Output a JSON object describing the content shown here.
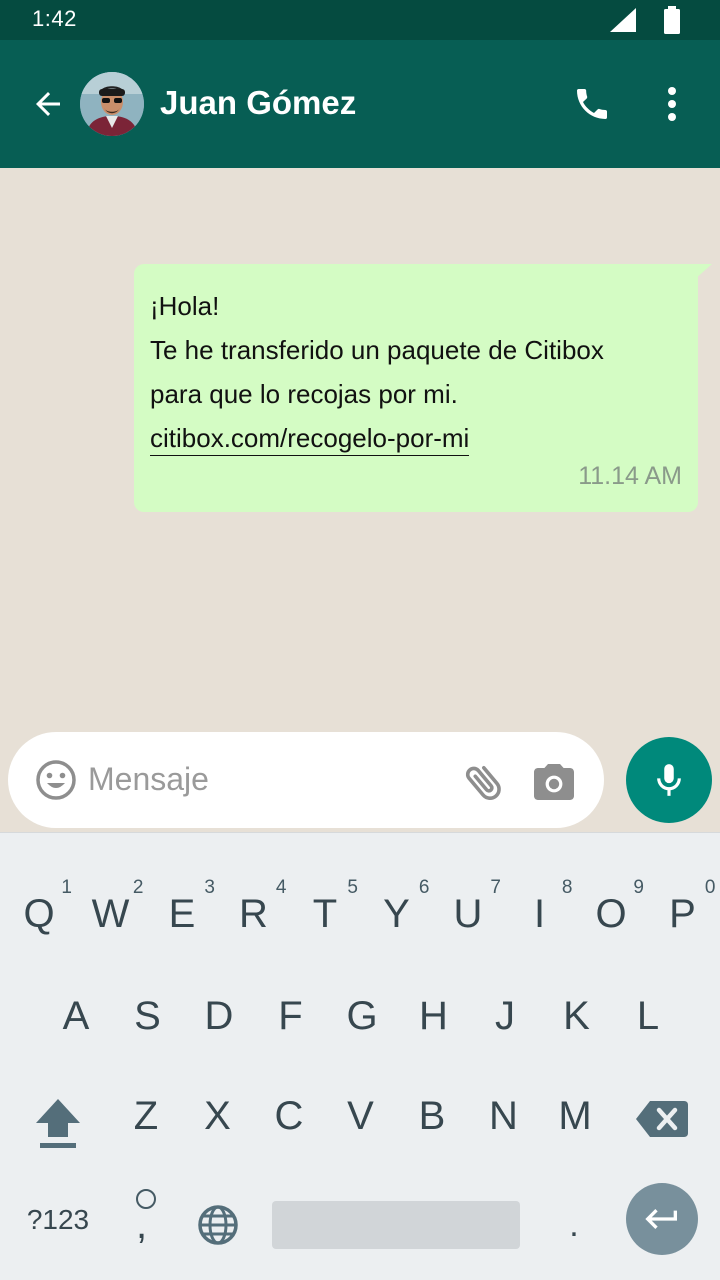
{
  "status_bar": {
    "time": "1:42"
  },
  "app_bar": {
    "contact_name": "Juan Gómez"
  },
  "chat": {
    "message": {
      "lines": [
        "¡Hola!",
        "Te he transferido un paquete de Citibox",
        "para que lo recojas por mi."
      ],
      "link": "citibox.com/recogelo-por-mi",
      "time": "11.14 AM"
    }
  },
  "composer": {
    "placeholder": "Mensaje"
  },
  "keyboard": {
    "row1": [
      {
        "key": "Q",
        "hint": "1"
      },
      {
        "key": "W",
        "hint": "2"
      },
      {
        "key": "E",
        "hint": "3"
      },
      {
        "key": "R",
        "hint": "4"
      },
      {
        "key": "T",
        "hint": "5"
      },
      {
        "key": "Y",
        "hint": "6"
      },
      {
        "key": "U",
        "hint": "7"
      },
      {
        "key": "I",
        "hint": "8"
      },
      {
        "key": "O",
        "hint": "9"
      },
      {
        "key": "P",
        "hint": "0"
      }
    ],
    "row2": [
      "A",
      "S",
      "D",
      "F",
      "G",
      "H",
      "J",
      "K",
      "L"
    ],
    "row3": [
      "Z",
      "X",
      "C",
      "V",
      "B",
      "N",
      "M"
    ],
    "symbols_label": "?123",
    "comma": ",",
    "period": "."
  },
  "colors": {
    "status_bar": "#054b40",
    "app_bar": "#075e54",
    "chat_background": "#e7e0d6",
    "outgoing_bubble": "#d4fcc4",
    "mic_button": "#00897b",
    "keyboard_background": "#eceff1"
  },
  "icons": {
    "back": "arrow-left-icon",
    "call": "phone-icon",
    "menu": "more-vert-icon",
    "emoji": "smiley-icon",
    "attach": "paperclip-icon",
    "camera": "camera-icon",
    "mic": "microphone-icon",
    "shift": "shift-icon",
    "backspace": "backspace-icon",
    "globe": "globe-icon",
    "enter": "enter-icon"
  }
}
